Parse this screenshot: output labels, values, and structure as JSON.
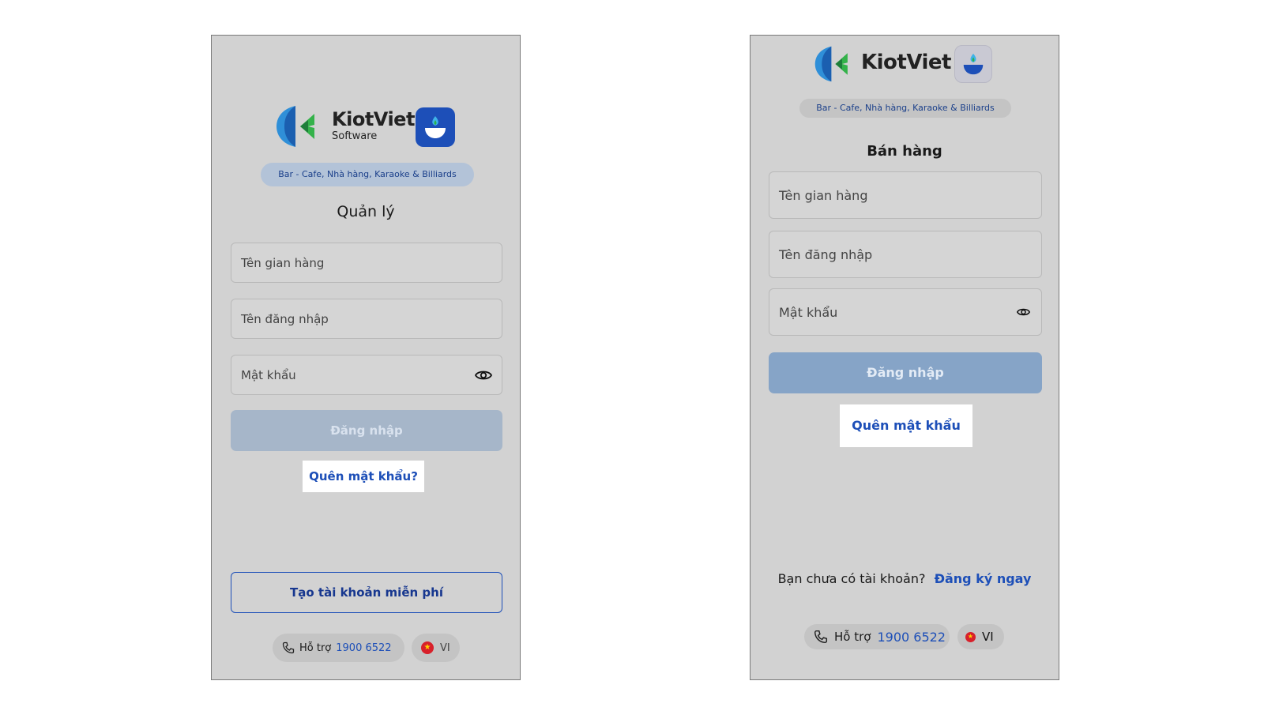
{
  "left": {
    "brand_name": "KiotViet",
    "brand_sub": "Software",
    "category": "Bar - Cafe, Nhà hàng, Karaoke & Billiards",
    "title": "Quản lý",
    "store_placeholder": "Tên gian hàng",
    "username_placeholder": "Tên đăng nhập",
    "password_placeholder": "Mật khẩu",
    "login_label": "Đăng nhập",
    "forgot_label": "Quên mật khẩu?",
    "create_account_label": "Tạo tài khoản miễn phí",
    "support_label": "Hỗ trợ",
    "support_phone": "1900 6522",
    "language": "VI"
  },
  "right": {
    "brand_name": "KiotViet",
    "category": "Bar - Cafe, Nhà hàng, Karaoke & Billiards",
    "title": "Bán hàng",
    "store_placeholder": "Tên gian hàng",
    "username_placeholder": "Tên đăng nhập",
    "password_placeholder": "Mật khẩu",
    "login_label": "Đăng nhập",
    "forgot_label": "Quên mật khẩu",
    "no_account_text": "Bạn chưa có tài khoản?",
    "register_label": "Đăng ký ngay",
    "support_label": "Hỗ trợ",
    "support_phone": "1900 6522",
    "language": "VI"
  },
  "colors": {
    "phone_bg": "#d2d2d2",
    "accent_blue": "#1d4fb8",
    "login_disabled_left": "#a6b6c9",
    "login_disabled_right": "#86a4c7"
  },
  "icons": {
    "brand_mark": "kiotviet-k-logo-icon",
    "app_icon": "fnb-bowl-app-icon",
    "eye": "eye-icon",
    "phone": "phone-icon",
    "flag": "vietnam-flag-icon"
  }
}
